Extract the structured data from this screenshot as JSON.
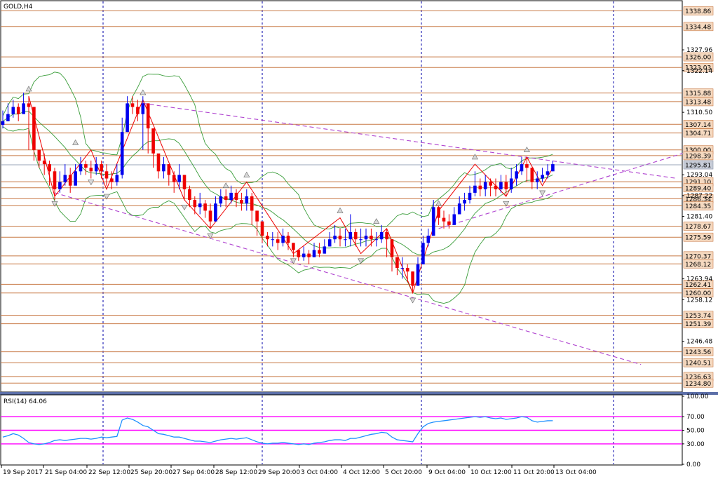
{
  "chart_data": {
    "type": "candlestick",
    "title": "GOLD,H4",
    "x_labels": [
      "19 Sep 2017",
      "21 Sep 04:00",
      "22 Sep 12:00",
      "25 Sep 20:00",
      "27 Sep 04:00",
      "28 Sep 12:00",
      "29 Sep 20:00",
      "3 Oct 04:00",
      "4 Oct 12:00",
      "5 Oct 20:00",
      "9 Oct 04:00",
      "10 Oct 12:00",
      "11 Oct 20:00",
      "13 Oct 04:00"
    ],
    "y_axis_ticks": [
      "1327.96",
      "1322.14",
      "1310.50",
      "1293.04",
      "1287.22",
      "1281.40",
      "1263.94",
      "1258.12",
      "1246.48"
    ],
    "ylim": [
      1232.5,
      1341.5
    ],
    "price_levels": [
      {
        "label": "1338.86",
        "value": 1338.86
      },
      {
        "label": "1334.48",
        "value": 1334.48
      },
      {
        "label": "1326.00",
        "value": 1326.0
      },
      {
        "label": "1323.03",
        "value": 1323.03
      },
      {
        "label": "1315.88",
        "value": 1315.88
      },
      {
        "label": "1313.48",
        "value": 1313.48
      },
      {
        "label": "1307.14",
        "value": 1307.14
      },
      {
        "label": "1304.71",
        "value": 1304.71
      },
      {
        "label": "1300.00",
        "value": 1300.0
      },
      {
        "label": "1298.39",
        "value": 1298.39
      },
      {
        "label": "1291.10",
        "value": 1291.1
      },
      {
        "label": "1289.40",
        "value": 1289.4
      },
      {
        "label": "1286.34",
        "value": 1286.34
      },
      {
        "label": "1284.35",
        "value": 1284.35
      },
      {
        "label": "1278.67",
        "value": 1278.67
      },
      {
        "label": "1275.59",
        "value": 1275.59
      },
      {
        "label": "1270.37",
        "value": 1270.37
      },
      {
        "label": "1268.12",
        "value": 1268.12
      },
      {
        "label": "1262.41",
        "value": 1262.41
      },
      {
        "label": "1260.00",
        "value": 1260.0
      },
      {
        "label": "1253.74",
        "value": 1253.74
      },
      {
        "label": "1251.39",
        "value": 1251.39
      },
      {
        "label": "1243.56",
        "value": 1243.56
      },
      {
        "label": "1240.51",
        "value": 1240.51
      },
      {
        "label": "1236.63",
        "value": 1236.63
      },
      {
        "label": "1234.80",
        "value": 1234.8
      }
    ],
    "current_price": {
      "label": "1295.81",
      "value": 1295.81
    },
    "close_prices": [
      1308,
      1310,
      1312,
      1310,
      1313,
      1312,
      1300,
      1297,
      1296,
      1294,
      1289,
      1291,
      1293,
      1290,
      1294,
      1296,
      1295,
      1294,
      1296,
      1294,
      1292,
      1291,
      1293,
      1305,
      1313,
      1312,
      1310,
      1313,
      1306,
      1299,
      1294,
      1296,
      1293,
      1291,
      1293,
      1289,
      1286,
      1284,
      1285,
      1283,
      1280,
      1285,
      1287,
      1286,
      1288,
      1286,
      1285,
      1287,
      1283,
      1280,
      1276,
      1275,
      1275,
      1274,
      1276,
      1274,
      1272,
      1270,
      1271,
      1270,
      1272,
      1271,
      1273,
      1275,
      1276,
      1275,
      1275,
      1277,
      1275,
      1275,
      1276,
      1275,
      1275,
      1277,
      1275,
      1270,
      1267,
      1267,
      1266,
      1262,
      1268,
      1274,
      1276,
      1284,
      1281,
      1280,
      1279,
      1282,
      1285,
      1286,
      1288,
      1290,
      1289,
      1291,
      1290,
      1289,
      1291,
      1289,
      1292,
      1294,
      1296,
      1295,
      1291,
      1292,
      1293,
      1294,
      1296
    ],
    "high_prices": [
      1311,
      1313,
      1314,
      1313,
      1316,
      1315,
      1310,
      1300,
      1299,
      1297,
      1295,
      1294,
      1296,
      1295,
      1296,
      1298,
      1297,
      1297,
      1298,
      1297,
      1296,
      1294,
      1296,
      1309,
      1315,
      1315,
      1314,
      1315,
      1313,
      1302,
      1297,
      1298,
      1296,
      1294,
      1296,
      1293,
      1290,
      1287,
      1288,
      1286,
      1285,
      1287,
      1289,
      1289,
      1290,
      1289,
      1288,
      1289,
      1288,
      1283,
      1280,
      1277,
      1277,
      1277,
      1278,
      1277,
      1274,
      1272,
      1273,
      1272,
      1274,
      1274,
      1275,
      1277,
      1279,
      1278,
      1278,
      1282,
      1278,
      1278,
      1278,
      1278,
      1277,
      1279,
      1278,
      1275,
      1269,
      1270,
      1268,
      1266,
      1270,
      1276,
      1278,
      1286,
      1285,
      1283,
      1282,
      1284,
      1287,
      1288,
      1290,
      1294,
      1292,
      1293,
      1292,
      1292,
      1293,
      1293,
      1295,
      1296,
      1298,
      1298,
      1295,
      1294,
      1295,
      1296,
      1297
    ],
    "low_prices": [
      1306,
      1308,
      1309,
      1308,
      1311,
      1300,
      1297,
      1295,
      1293,
      1290,
      1286,
      1288,
      1290,
      1288,
      1291,
      1293,
      1293,
      1292,
      1293,
      1292,
      1290,
      1289,
      1290,
      1292,
      1305,
      1310,
      1308,
      1300,
      1299,
      1295,
      1292,
      1292,
      1290,
      1288,
      1289,
      1286,
      1284,
      1282,
      1282,
      1281,
      1278,
      1280,
      1284,
      1284,
      1285,
      1284,
      1283,
      1283,
      1279,
      1276,
      1274,
      1273,
      1273,
      1272,
      1273,
      1272,
      1270,
      1269,
      1269,
      1268,
      1270,
      1270,
      1271,
      1273,
      1274,
      1273,
      1273,
      1273,
      1273,
      1273,
      1273,
      1273,
      1273,
      1274,
      1270,
      1266,
      1265,
      1264,
      1263,
      1260,
      1262,
      1268,
      1273,
      1276,
      1279,
      1278,
      1278,
      1279,
      1282,
      1283,
      1285,
      1287,
      1287,
      1287,
      1287,
      1287,
      1288,
      1287,
      1288,
      1290,
      1293,
      1291,
      1289,
      1289,
      1291,
      1292,
      1294
    ],
    "indicator": {
      "name": "RSI(14)",
      "value_label": "64.06",
      "axis_ticks": [
        "100.00",
        "70.00",
        "50.00",
        "30.00",
        "0.00"
      ],
      "levels": [
        70,
        50,
        30
      ],
      "values": [
        40,
        42,
        45,
        43,
        38,
        32,
        30,
        29,
        30,
        32,
        35,
        36,
        35,
        36,
        37,
        38,
        38,
        37,
        38,
        40,
        39,
        40,
        41,
        65,
        68,
        66,
        62,
        57,
        55,
        50,
        45,
        44,
        42,
        40,
        40,
        38,
        36,
        34,
        34,
        33,
        32,
        34,
        36,
        37,
        38,
        37,
        38,
        39,
        36,
        33,
        31,
        30,
        31,
        31,
        32,
        31,
        30,
        29,
        30,
        29,
        31,
        32,
        33,
        35,
        36,
        36,
        35,
        38,
        38,
        40,
        42,
        44,
        45,
        47,
        46,
        40,
        36,
        35,
        34,
        33,
        45,
        55,
        60,
        62,
        63,
        64,
        65,
        66,
        67,
        68,
        69,
        70,
        69,
        70,
        68,
        67,
        68,
        66,
        67,
        68,
        70,
        69,
        64,
        62,
        63,
        64,
        64.06
      ],
      "ylim": [
        0,
        100
      ]
    },
    "colors": {
      "bull": "#0000ee",
      "bear": "#ee0000",
      "level_line": "#c87a46",
      "trendline": "#b044d0",
      "band": "#3a9d3a",
      "rsi_line": "#1e8fff",
      "rsi_level": "#ff00ff",
      "vgrid": "#0000aa"
    }
  }
}
